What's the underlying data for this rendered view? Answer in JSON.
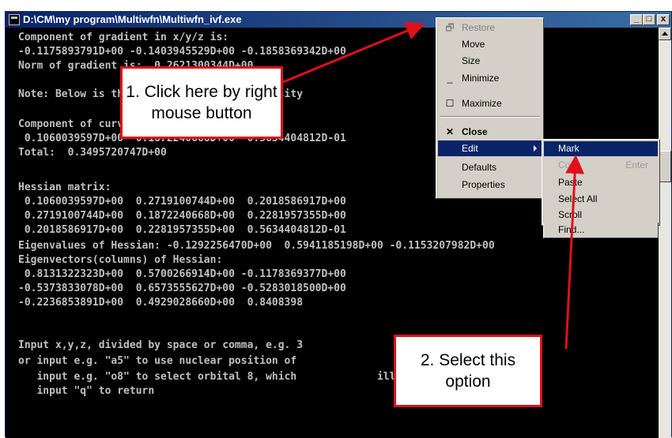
{
  "window": {
    "title": "D:\\CM\\my program\\Multiwfn\\Multiwfn_ivf.exe",
    "controls": {
      "minimize": "_",
      "maximize": "□",
      "close": "x"
    }
  },
  "console_lines": [
    "Component of gradient in x/y/z is:",
    "-0.1175893791D+00 -0.1403945529D+00 -0.1858369342D+00",
    "Norm of gradient is:  0.2621300344D+00",
    "",
    "Note: Below is the Hessian of electron density",
    "",
    "Component of curvature in x/y/z is:",
    " 0.1060039597D+00  0.1872240668D+00  0.5634404812D-01",
    "Total:  0.3495720747D+00",
    "",
    "Hessian matrix:",
    " 0.1060039597D+00  0.2719100744D+00  0.2018586917D+00",
    " 0.2719100744D+00  0.1872240668D+00  0.2281957355D+00",
    " 0.2018586917D+00  0.2281957355D+00  0.5634404812D-01",
    "Eigenvalues of Hessian: -0.1292256470D+00  0.5941185198D+00 -0.1153207982D+00",
    "Eigenvectors(columns) of Hessian:",
    " 0.8131322323D+00  0.5700266914D+00 -0.1178369377D+00",
    "-0.5373833078D+00  0.6573555627D+00 -0.5283018500D+00",
    "-0.2236853891D+00  0.4929028660D+00  0.8408398",
    "",
    "Input x,y,z, divided by space or comma, e.g. 3",
    "or input e.g. \"a5\" to use nuclear position of",
    "   input e.g. \"o8\" to select orbital 8, which             ill be shown",
    "   input \"q\" to return"
  ],
  "context_menu": {
    "items": [
      {
        "label": "Restore",
        "icon": "restore-icon",
        "glyph": "🗗",
        "disabled": true
      },
      {
        "label": "Move",
        "icon": "",
        "glyph": "",
        "disabled": false
      },
      {
        "label": "Size",
        "icon": "",
        "glyph": "",
        "disabled": false
      },
      {
        "label": "Minimize",
        "icon": "minimize-icon",
        "glyph": "_",
        "disabled": false
      },
      {
        "label": "Maximize",
        "icon": "maximize-icon",
        "glyph": "☐",
        "disabled": false
      },
      {
        "label": "Close",
        "icon": "close-icon",
        "glyph": "✕",
        "disabled": false
      },
      {
        "label": "Edit",
        "icon": "",
        "glyph": "",
        "disabled": false
      },
      {
        "label": "Defaults",
        "icon": "",
        "glyph": "",
        "disabled": false
      },
      {
        "label": "Properties",
        "icon": "",
        "glyph": "",
        "disabled": false
      }
    ]
  },
  "edit_submenu": {
    "items": [
      {
        "label": "Mark",
        "accelerator": ""
      },
      {
        "label": "Copy",
        "accelerator": "Enter"
      },
      {
        "label": "Paste",
        "accelerator": ""
      },
      {
        "label": "Select All",
        "accelerator": ""
      },
      {
        "label": "Scroll",
        "accelerator": ""
      },
      {
        "label": "Find...",
        "accelerator": ""
      }
    ]
  },
  "callouts": {
    "step1": "1. Click here by right mouse button",
    "step2": "2. Select this option"
  },
  "colors": {
    "annotation": "#e0101a",
    "highlight": "#0a246a",
    "console_bg": "#000000",
    "console_text": "#c0c0c0"
  }
}
